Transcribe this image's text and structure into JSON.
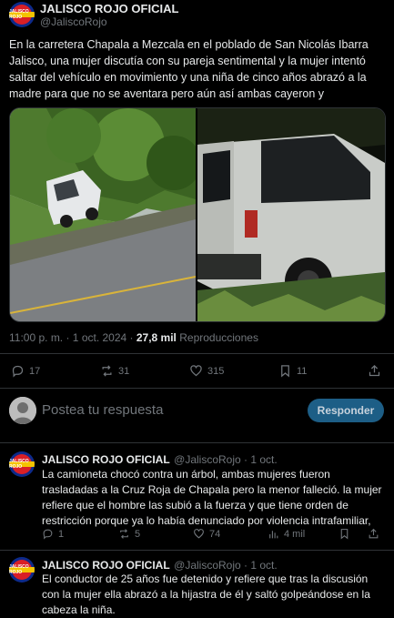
{
  "post": {
    "author_name": "JALISCO ROJO OFICIAL",
    "author_handle": "@JaliscoRojo",
    "avatar_text": "JALISCO ROJO",
    "text": "En la carretera Chapala a Mezcala en el poblado de San Nicolás Ibarra Jalisco, una mujer discutía con su pareja sentimental y la mujer intentó saltar del vehículo en movimiento y una niña de cinco años abrazó a la madre para que no se aventara pero aún así ambas cayeron y",
    "time": "11:00 p. m. · 1 oct. 2024 · ",
    "views_count": "27,8 mil",
    "views_label": " Reproducciones",
    "replies": "17",
    "reposts": "31",
    "likes": "315",
    "bookmarks": "11"
  },
  "compose": {
    "placeholder": "Postea tu respuesta",
    "button": "Responder"
  },
  "replies": [
    {
      "author_name": "JALISCO ROJO OFICIAL",
      "author_handle": "@JaliscoRojo · 1 oct.",
      "text": "La camioneta chocó contra un árbol, ambas mujeres fueron trasladadas a la Cruz Roja de Chapala pero  la menor falleció. la mujer refiere que el hombre las subió a la fuerza y que tiene orden de restricción porque ya lo había denunciado por violencia intrafamiliar,",
      "replies": "1",
      "reposts": "5",
      "likes": "74",
      "views": "4 mil"
    },
    {
      "author_name": "JALISCO ROJO OFICIAL",
      "author_handle": "@JaliscoRojo · 1 oct.",
      "text": "El conductor de 25 años fue detenido y refiere que tras la discusión con la mujer ella abrazó a la hijastra de él y saltó golpeándose en la cabeza la niña."
    }
  ],
  "colors": {
    "background": "#000000",
    "text": "#e7e9ea",
    "muted": "#71767b",
    "divider": "#2f3336",
    "reply_button": "#1d5e86"
  }
}
